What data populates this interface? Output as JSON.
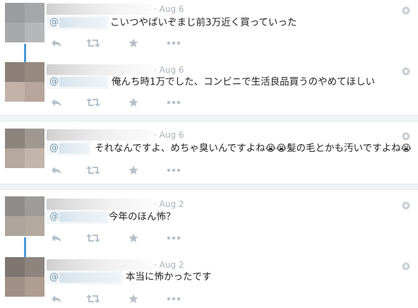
{
  "colors": {
    "accent": "#4a98d8",
    "action_icon": "#b6c1ca",
    "date": "#a8b1ba"
  },
  "icons": [
    "reply-icon",
    "retweet-icon",
    "like-icon",
    "more-icon",
    "settings-icon"
  ],
  "tweets": [
    {
      "date": "· Aug 6",
      "at": "@",
      "text": "こいつやばいぞまじ前3万近く買っていった"
    },
    {
      "date": "· Aug 6",
      "at": "@",
      "text": "俺んち時1万でした、コンビニで生活良品買うのやめてほしい"
    },
    {
      "date": "· Aug 6",
      "at": "@",
      "text_a": "それなんですよ、めちゃ臭いんですよね",
      "emoji": "😭😭",
      "text_b": "髪の毛とかも汚いですよね",
      "emoji2": "😭"
    },
    {
      "date": "· Aug 2",
      "at": "@",
      "text": "今年のほん怖？"
    },
    {
      "date": "· Aug 2",
      "at": "@",
      "text": "本当に怖かったです"
    }
  ]
}
